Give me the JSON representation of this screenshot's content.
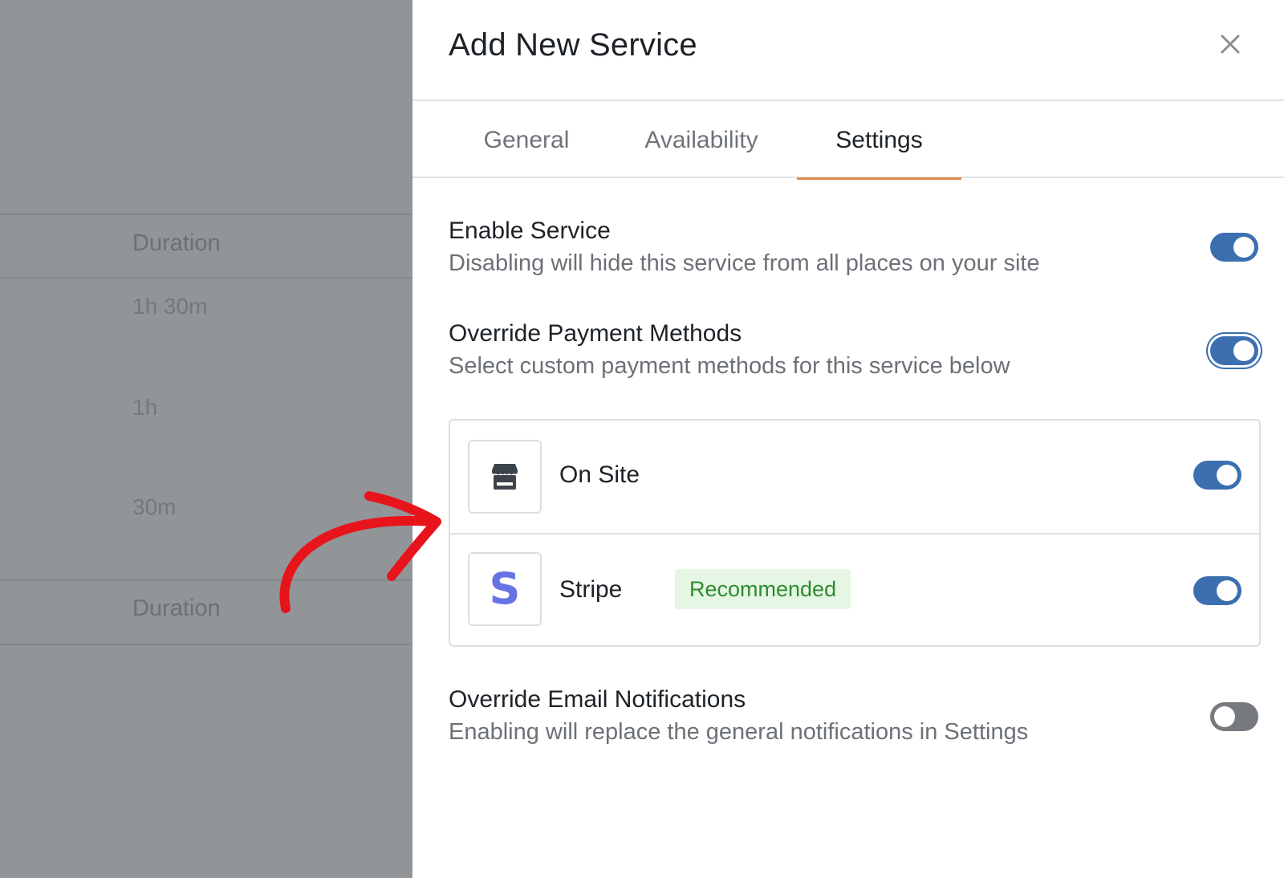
{
  "backdrop": {
    "header_1": "Duration",
    "rows": [
      "1h 30m",
      "1h",
      "30m"
    ],
    "header_2": "Duration"
  },
  "drawer": {
    "title": "Add New Service",
    "close_icon": "close-icon"
  },
  "tabs": [
    {
      "label": "General",
      "active": false
    },
    {
      "label": "Availability",
      "active": false
    },
    {
      "label": "Settings",
      "active": true
    }
  ],
  "settings": {
    "enable_service": {
      "title": "Enable Service",
      "description": "Disabling will hide this service from all places on your site",
      "enabled": true
    },
    "override_payment": {
      "title": "Override Payment Methods",
      "description": "Select custom payment methods for this service below",
      "enabled": true
    },
    "payment_methods": [
      {
        "name": "On Site",
        "icon": "storefront-icon",
        "enabled": true
      },
      {
        "name": "Stripe",
        "icon": "stripe-logo-icon",
        "badge": "Recommended",
        "enabled": true
      }
    ],
    "override_email": {
      "title": "Override Email Notifications",
      "description": "Enabling will replace the general notifications in Settings",
      "enabled": false
    }
  },
  "colors": {
    "accent_tab": "#e4894f",
    "toggle_on": "#3b6fb0",
    "toggle_off": "#76797e",
    "badge_bg": "#e6f6e4",
    "badge_text": "#2e8b2e",
    "stripe_purple": "#6772e5",
    "annotation_arrow": "#e8141c"
  }
}
